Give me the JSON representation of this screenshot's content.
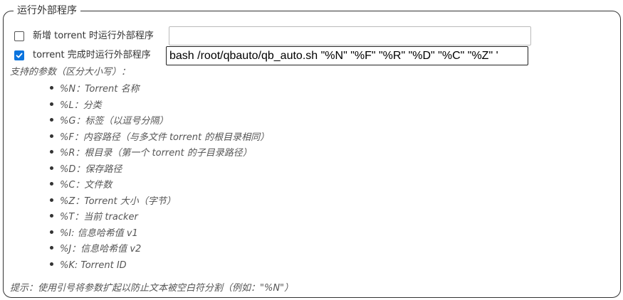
{
  "section": {
    "title": "运行外部程序"
  },
  "on_add": {
    "checked": false,
    "label": "新增 torrent 时运行外部程序",
    "value": ""
  },
  "on_finish": {
    "checked": true,
    "label": "torrent 完成时运行外部程序",
    "value": "bash /root/qbauto/qb_auto.sh \"%N\" \"%F\" \"%R\" \"%D\" \"%C\" \"%Z\" '"
  },
  "supported": {
    "title": "支持的参数（区分大小写）：",
    "params": [
      "%N：Torrent 名称",
      "%L：分类",
      "%G：标签（以逗号分隔）",
      "%F：内容路径（与多文件 torrent 的根目录相同）",
      "%R：根目录（第一个 torrent 的子目录路径）",
      "%D：保存路径",
      "%C：文件数",
      "%Z：Torrent 大小（字节）",
      "%T：当前 tracker",
      "%I: 信息哈希值 v1",
      "%J：信息哈希值 v2",
      "%K: Torrent ID"
    ]
  },
  "hint": "提示：使用引号将参数扩起以防止文本被空白符分割（例如：\"%N\"）",
  "colors": {
    "checkbox_checked": "#0b74de",
    "border": "#333333",
    "italic_text": "#555555"
  }
}
